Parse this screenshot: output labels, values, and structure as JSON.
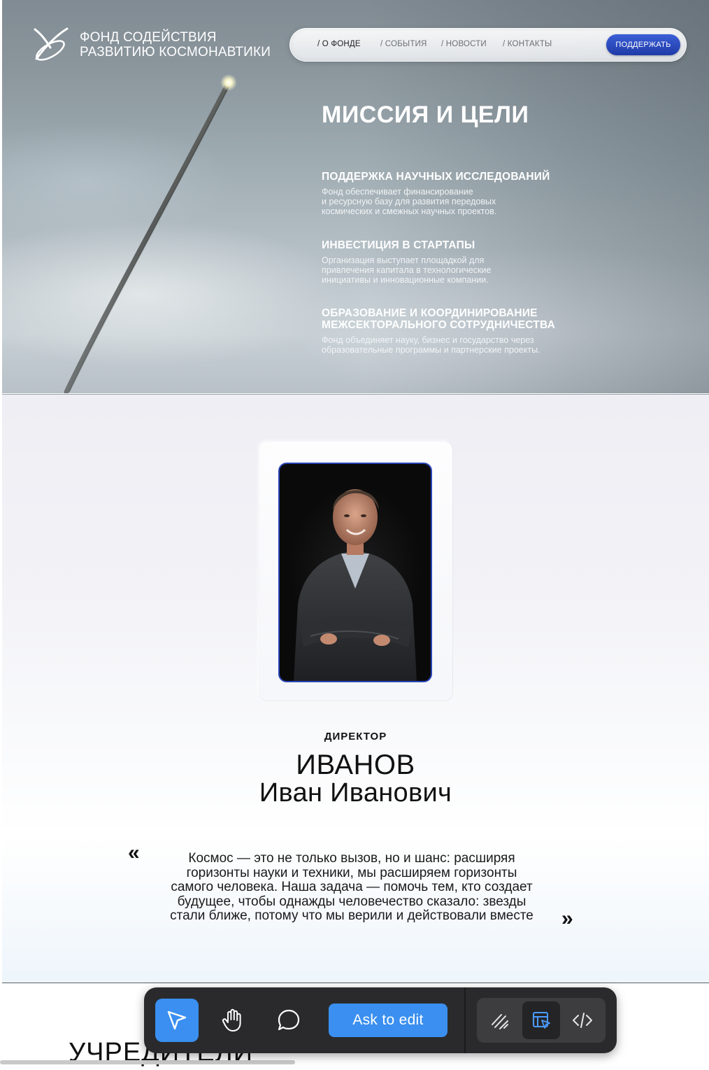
{
  "header": {
    "logo_line1": "ФОНД СОДЕЙСТВИЯ",
    "logo_line2": "РАЗВИТИЮ КОСМОНАВТИКИ",
    "nav": [
      "/ О ФОНДЕ",
      "/ СОБЫТИЯ",
      "/ НОВОСТИ",
      "/ КОНТАКТЫ"
    ],
    "support_label": "ПОДДЕРЖАТЬ"
  },
  "mission": {
    "title": "МИССИЯ И ЦЕЛИ",
    "goals": [
      {
        "title": "ПОДДЕРЖКА НАУЧНЫХ ИССЛЕДОВАНИЙ",
        "lines": [
          "Фонд обеспечивает финансирование",
          "и ресурсную базу для развития передовых",
          "космических и смежных научных проектов."
        ]
      },
      {
        "title": "ИНВЕСТИЦИЯ В СТАРТАПЫ",
        "lines": [
          "Организация выступает площадкой для",
          "привлечения капитала в технологические",
          "инициативы и инновационные компании."
        ]
      },
      {
        "title_lines": [
          "ОБРАЗОВАНИЕ И КООРДИНИРОВАНИЕ",
          "МЕЖСЕКТОРАЛЬНОГО СОТРУДНИЧЕСТВА"
        ],
        "lines": [
          "Фонд объединяет науку, бизнес и государство через",
          "образовательные программы и партнерские проекты."
        ]
      }
    ]
  },
  "director": {
    "role": "ДИРЕКТОР",
    "surname": "ИВАНОВ",
    "given_name": "Иван Иванович",
    "quote_open": "«",
    "quote_close": "»",
    "quote_lines": [
      "Космос — это не только вызов, но и шанс: расширяя",
      "горизонты науки и техники, мы расширяем горизонты",
      "самого человека. Наша задача — помочь тем, кто создает",
      "будущее, чтобы однажды человечество сказало: звезды",
      "стали ближе, потому что мы верили и действовали вместе"
    ]
  },
  "founders": {
    "title": "УЧРЕДИТЕЛИ"
  },
  "toolbar": {
    "ask_label": "Ask to edit",
    "tools": [
      "pointer-icon",
      "hand-icon",
      "comment-icon",
      "draw-icon",
      "inspect-icon",
      "code-icon"
    ]
  },
  "colors": {
    "accent": "#3a8ff0",
    "brand_blue": "#2a45b8",
    "toolbar_bg": "#2a2a2c"
  }
}
